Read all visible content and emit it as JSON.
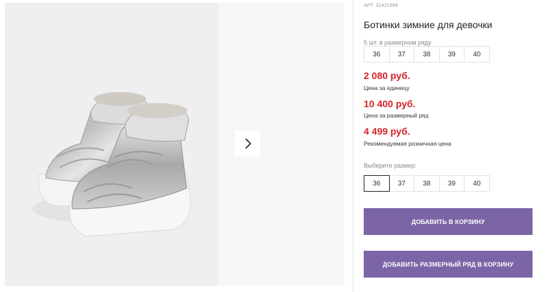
{
  "gallery": {
    "main_image_alt": "boots-photo",
    "next_icon": "chevron-right-icon"
  },
  "product": {
    "article": "АРТ. 32421966",
    "title": "Ботинки зимние для девочки",
    "pack_label": "5 шт. в размерном ряду",
    "pack_sizes": [
      "36",
      "37",
      "38",
      "39",
      "40"
    ],
    "unit_price": "2 080 руб.",
    "unit_price_note": "Цена за единицу",
    "pack_price": "10 400 руб.",
    "pack_price_note": "Цена за размерный ряд",
    "retail_price": "4 499 руб.",
    "retail_price_note": "Рекомендуемая розничная цена",
    "choose_size_label": "Выберите размер:",
    "choose_sizes": [
      "36",
      "37",
      "38",
      "39",
      "40"
    ],
    "selected_size": "36"
  },
  "actions": {
    "add_to_cart": "ДОБАВИТЬ В КОРЗИНУ",
    "add_pack_to_cart": "ДОБАВИТЬ РАЗМЕРНЫЙ РЯД В КОРЗИНУ"
  },
  "colors": {
    "accent": "#7b65a6",
    "price": "#d2232a"
  }
}
